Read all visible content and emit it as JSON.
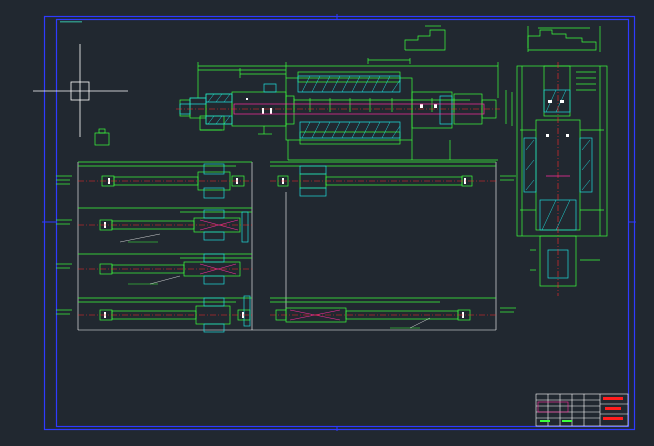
{
  "sheet": {
    "title_block_rows": [
      "",
      "",
      ""
    ],
    "callouts": [
      "",
      "",
      "",
      ""
    ]
  },
  "colors": {
    "background": "#212830",
    "border": "#2f3aff",
    "geometry": "#3cff3c",
    "hatch": "#1edcdc",
    "centerline": "#ff2828",
    "crosshair": "#ffffff",
    "title_red": "#ff1e1e"
  },
  "icons": {
    "cursor": "crosshair-icon"
  }
}
